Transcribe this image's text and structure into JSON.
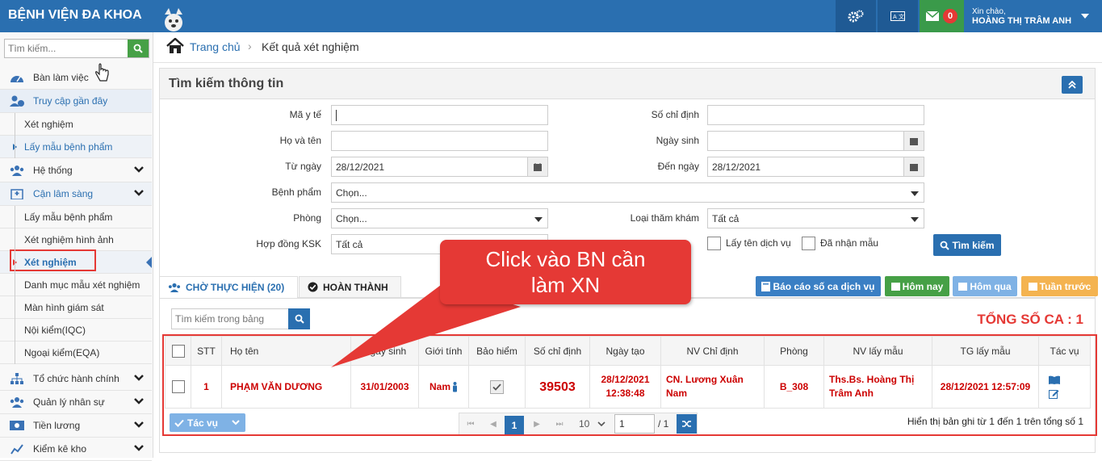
{
  "header": {
    "brand": "BỆNH VIỆN ĐA KHOA",
    "greeting": "Xin chào,",
    "user": "HOÀNG THỊ TRÂM ANH",
    "mail_count": "0"
  },
  "sidebar": {
    "search_placeholder": "Tìm kiếm...",
    "items": {
      "dashboard": "Bàn làm việc",
      "recent": "Truy cập gần đây",
      "xet_nghiem": "Xét nghiệm",
      "lay_mau_bp": "Lấy mẫu bệnh phẩm",
      "he_thong": "Hệ thống",
      "can_lam_sang": "Cận lâm sàng",
      "lay_mau": "Lấy mẫu bệnh phẩm",
      "xn_hinh_anh": "Xét nghiệm hình ảnh",
      "xn_active": "Xét nghiệm",
      "dm_mau": "Danh mục mẫu xét nghiệm",
      "mh_giam_sat": "Màn hình giám sát",
      "noi_kiem": "Nội kiểm(IQC)",
      "ngoai_kiem": "Ngoại kiểm(EQA)",
      "to_chuc": "Tổ chức hành chính",
      "nhan_su": "Quản lý nhân sự",
      "tien_luong": "Tiền lương",
      "kiem_ke": "Kiểm kê kho"
    }
  },
  "breadcrumb": {
    "home": "Trang chủ",
    "current": "Kết quả xét nghiệm"
  },
  "search_panel": {
    "title": "Tìm kiếm thông tin",
    "labels": {
      "ma_y_te": "Mã y tế",
      "ho_ten": "Họ và tên",
      "tu_ngay": "Từ ngày",
      "benh_pham": "Bệnh phẩm",
      "phong": "Phòng",
      "hop_dong": "Hợp đồng KSK",
      "so_chi_dinh": "Số chỉ định",
      "ngay_sinh": "Ngày sinh",
      "den_ngay": "Đến ngày",
      "loai_tham_kham": "Loại thăm khám"
    },
    "values": {
      "tu_ngay": "28/12/2021",
      "den_ngay": "28/12/2021",
      "benh_pham": "Chọn...",
      "phong": "Chọn...",
      "hop_dong": "Tất cả",
      "loai_tham_kham": "Tất cả"
    },
    "checks": {
      "lay_ten_dv": "Lấy tên dịch vụ",
      "da_nhan_mau": "Đã nhận mẫu"
    },
    "search_btn": "Tìm kiếm"
  },
  "tabs": {
    "pending": "CHỜ THỰC HIỆN (20)",
    "done": "HOÀN THÀNH"
  },
  "actions": {
    "report": "Báo cáo số ca dịch vụ",
    "today": "Hôm nay",
    "yesterday": "Hôm qua",
    "last_week": "Tuần trước"
  },
  "table": {
    "search_placeholder": "Tìm kiếm trong bảng",
    "total": "TỔNG SỐ CA : 1",
    "headers": [
      "STT",
      "Họ tên",
      "Ngày sinh",
      "Giới tính",
      "Bảo hiểm",
      "Số chỉ định",
      "Ngày tạo",
      "NV Chỉ định",
      "Phòng",
      "NV lấy mẫu",
      "TG lấy mẫu",
      "Tác vụ"
    ],
    "row": {
      "stt": "1",
      "ho_ten": "PHẠM VĂN DƯƠNG",
      "ngay_sinh": "31/01/2003",
      "gioi_tinh": "Nam",
      "so_chi_dinh": "39503",
      "ngay_tao": "28/12/2021 12:38:48",
      "nv_chi_dinh": "CN. Lương Xuân Nam",
      "phong": "B_308",
      "nv_lay_mau": "Ths.Bs. Hoàng Thị Trâm Anh",
      "tg_lay_mau": "28/12/2021 12:57:09"
    }
  },
  "footer": {
    "bulk_action": "Tác vụ",
    "page": "1",
    "page_size": "10",
    "page_input": "1",
    "page_total": "/ 1",
    "info": "Hiển thị bản ghi từ 1 đến 1 trên tổng số 1"
  },
  "callout": {
    "text": "Click vào BN cần làm XN"
  },
  "colors": {
    "primary": "#2a6fb0",
    "accent": "#e53935",
    "green": "#46a046"
  }
}
